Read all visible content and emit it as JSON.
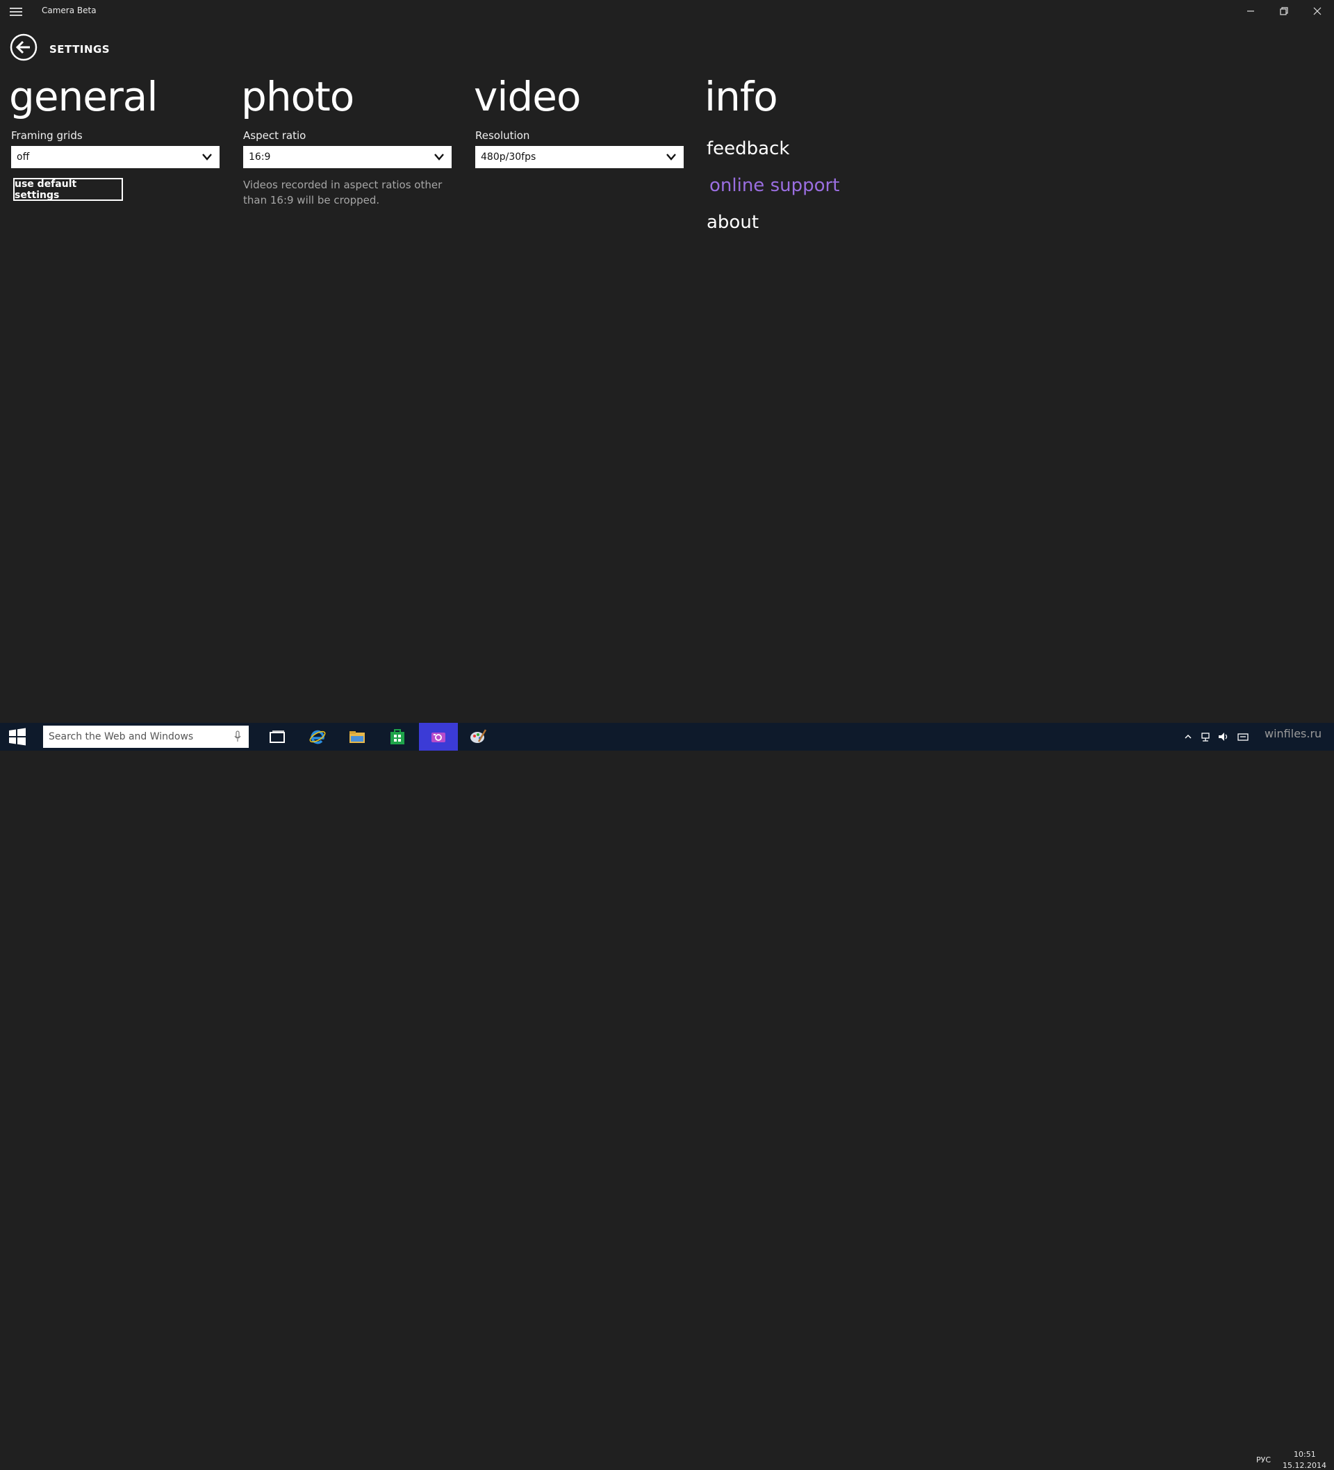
{
  "app": {
    "title": "Camera Beta",
    "page_header": "SETTINGS"
  },
  "sections": {
    "general": {
      "title": "general",
      "framing_label": "Framing grids",
      "framing_value": "off",
      "default_button": "use default settings"
    },
    "photo": {
      "title": "photo",
      "aspect_label": "Aspect ratio",
      "aspect_value": "16:9",
      "note": "Videos recorded in aspect ratios other than 16:9 will be cropped."
    },
    "video": {
      "title": "video",
      "resolution_label": "Resolution",
      "resolution_value": "480p/30fps"
    },
    "info": {
      "title": "info",
      "links": [
        "feedback",
        "online support",
        "about"
      ]
    }
  },
  "colors": {
    "background": "#202020",
    "accent_link": "#9a6ee0",
    "taskbar": "#0e1a2b",
    "active_app": "#3b3bd6"
  },
  "taskbar": {
    "search_placeholder": "Search the Web and Windows",
    "icons": [
      "windows-start-icon",
      "microphone-icon",
      "task-view-icon",
      "internet-explorer-icon",
      "file-explorer-icon",
      "store-icon",
      "camera-icon",
      "paint-icon"
    ],
    "language": "РУС",
    "time": "10:51",
    "date": "15.12.2014"
  },
  "watermark": "winfiles.ru"
}
